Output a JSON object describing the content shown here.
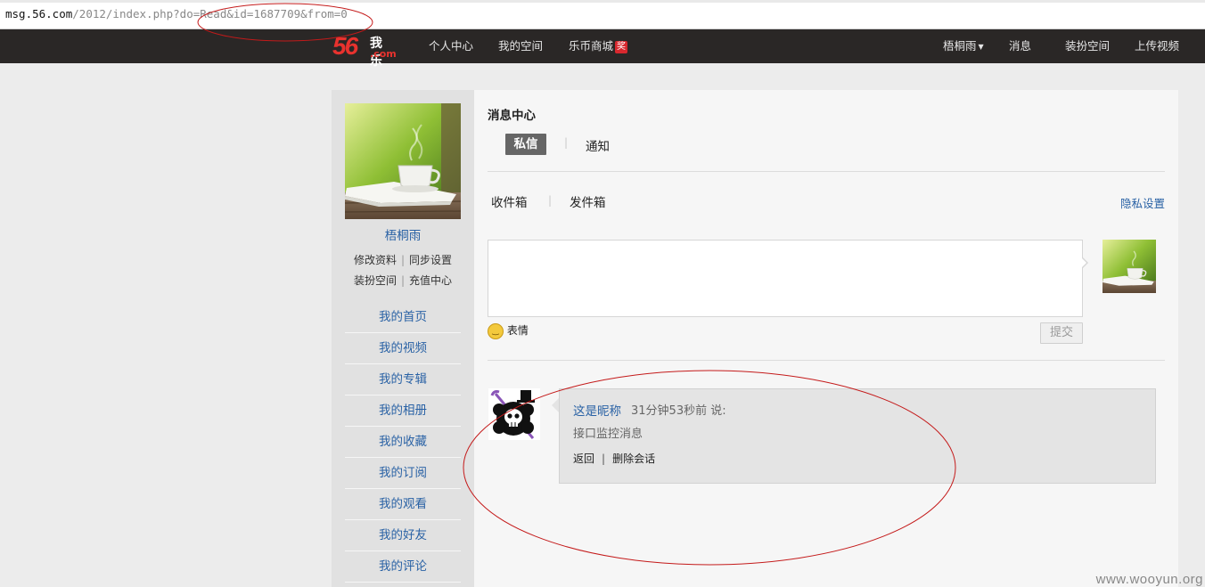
{
  "address_bar": {
    "host": "msg.56.com",
    "path": "/2012/index.php?do=Read&id=1687709&from=0"
  },
  "topnav": {
    "logo_number": "56",
    "logo_text": "我乐",
    "logo_domain": ".com",
    "items": [
      {
        "label": "个人中心"
      },
      {
        "label": "我的空间"
      },
      {
        "label": "乐币商城",
        "badge": "奖"
      }
    ],
    "user_menu": "梧桐雨",
    "right_items": [
      {
        "label": "消息"
      },
      {
        "label": "装扮空间"
      },
      {
        "label": "上传视频"
      }
    ]
  },
  "sidebar": {
    "username": "梧桐雨",
    "links_row1": [
      "修改资料",
      "同步设置"
    ],
    "links_row2": [
      "装扮空间",
      "充值中心"
    ],
    "menu": [
      {
        "label": "我的首页"
      },
      {
        "label": "我的视频"
      },
      {
        "label": "我的专辑"
      },
      {
        "label": "我的相册"
      },
      {
        "label": "我的收藏"
      },
      {
        "label": "我的订阅"
      },
      {
        "label": "我的观看"
      },
      {
        "label": "我的好友"
      },
      {
        "label": "我的评论"
      }
    ]
  },
  "main": {
    "title": "消息中心",
    "tabs": [
      {
        "label": "私信"
      },
      {
        "label": "通知"
      }
    ],
    "subtabs": [
      {
        "label": "收件箱"
      },
      {
        "label": "发件箱"
      }
    ],
    "privacy_link": "隐私设置",
    "composer": {
      "emoji_label": "表情",
      "submit_label": "提交"
    },
    "message": {
      "nickname": "这是昵称",
      "time": "31分钟53秒前",
      "says": "说:",
      "content": "接口监控消息",
      "back_label": "返回",
      "delete_label": "删除会话"
    }
  },
  "watermark": "www.wooyun.org",
  "colors": {
    "nav_bg": "#2a2726",
    "link_blue": "#2a62a5",
    "logo_red": "#e8322e",
    "annotation_red": "#c41a1a"
  }
}
